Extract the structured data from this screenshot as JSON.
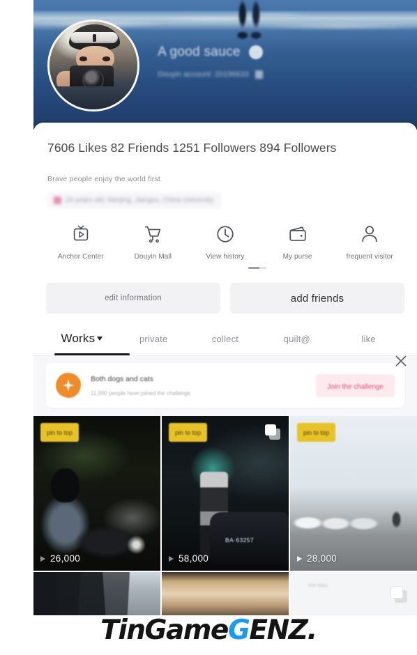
{
  "profile": {
    "cover_name": "A good sauce",
    "cover_subtitle": "Douyin account: 20196633",
    "stats_line": "7606 Likes 82 Friends 1251 Followers 894 Followers",
    "bio": "Brave people enjoy the world first",
    "tag_text": "24 years old, Nanjing, Jiangsu, China University"
  },
  "quick_actions": [
    {
      "label": "Anchor Center",
      "icon": "tv-play-icon"
    },
    {
      "label": "Douyin Mall",
      "icon": "shopping-cart-icon"
    },
    {
      "label": "View history",
      "icon": "clock-icon"
    },
    {
      "label": "My purse",
      "icon": "wallet-icon"
    },
    {
      "label": "frequent visitor",
      "icon": "person-icon"
    }
  ],
  "action_buttons": {
    "edit": "edit information",
    "add_friends": "add friends"
  },
  "tabs": [
    {
      "label": "Works",
      "active": true,
      "has_caret": true
    },
    {
      "label": "private",
      "active": false,
      "has_caret": false
    },
    {
      "label": "collect",
      "active": false,
      "has_caret": false
    },
    {
      "label": "quilt@",
      "active": false,
      "has_caret": false
    },
    {
      "label": "like",
      "active": false,
      "has_caret": false
    }
  ],
  "banner": {
    "title": "Both dogs and cats",
    "subtitle": "11,000 people have joined the challenge",
    "button_label": "Join the challenge",
    "close_icon": "close-icon",
    "icon": "sparkle-badge-icon",
    "icon_color": "#f08b2a",
    "button_bg": "#fdeaef",
    "button_text_color": "#e05070"
  },
  "videos": [
    {
      "pin_label": "pin to top",
      "views": "26,000",
      "multi": false
    },
    {
      "pin_label": "pin to top",
      "views": "58,000",
      "multi": true,
      "plate": "BA·63257"
    },
    {
      "pin_label": "pin to top",
      "views": "28,000",
      "multi": false
    }
  ],
  "watermark": {
    "part1": "TinGame",
    "part2": "G",
    "part3": "ENZ."
  },
  "colors": {
    "cover": "#2a4e82",
    "pin_badge": "#e8c328",
    "tab_active": "#18191b",
    "sheet_bg": "#ffffff"
  }
}
